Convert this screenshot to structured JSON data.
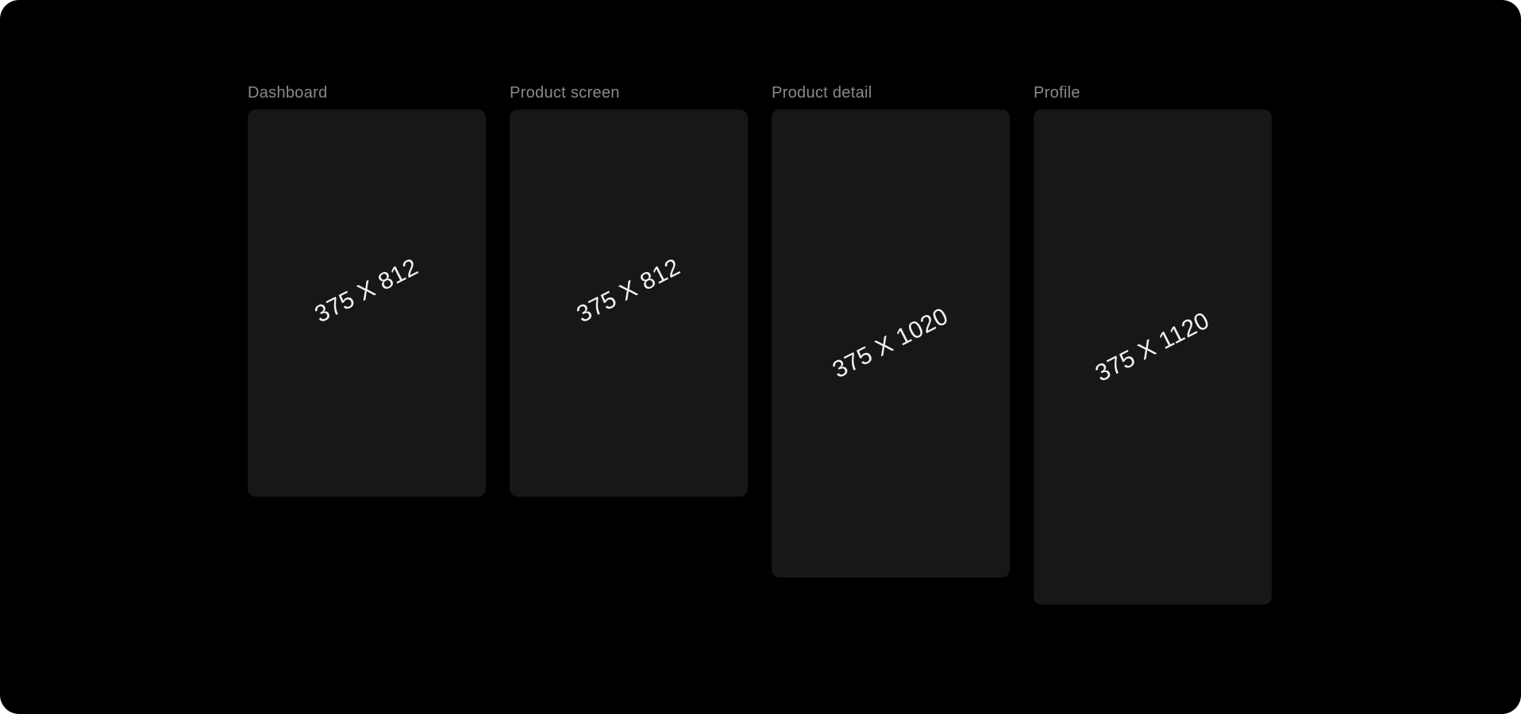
{
  "canvas": {
    "background": "#000000",
    "card_color": "#171717",
    "label_color": "#8a8a8a",
    "dims_color": "#f2f2f2"
  },
  "frames": [
    {
      "label": "Dashboard",
      "dimensions": "375 X 812"
    },
    {
      "label": "Product screen",
      "dimensions": "375 X 812"
    },
    {
      "label": "Product detail",
      "dimensions": "375 X 1020"
    },
    {
      "label": "Profile",
      "dimensions": "375 X 1120"
    }
  ]
}
